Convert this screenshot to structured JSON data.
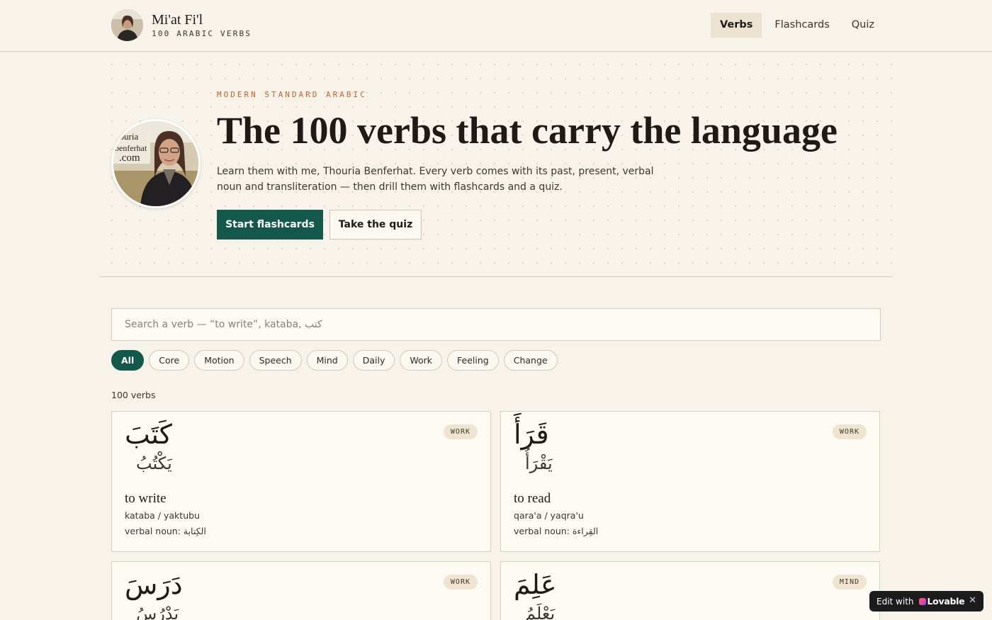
{
  "header": {
    "title": "Mi'at Fi'l",
    "subtitle": "100 ARABIC VERBS",
    "nav": [
      {
        "label": "Verbs",
        "active": true
      },
      {
        "label": "Flashcards",
        "active": false
      },
      {
        "label": "Quiz",
        "active": false
      }
    ]
  },
  "hero": {
    "eyebrow": "MODERN STANDARD ARABIC",
    "title": "The 100 verbs that carry the language",
    "description": "Learn them with me, Thouria Benferhat. Every verb comes with its past, present, verbal noun and transliteration — then drill them with flashcards and a quiz.",
    "primary_button": "Start flashcards",
    "secondary_button": "Take the quiz"
  },
  "search": {
    "placeholder": "Search a verb — “to write”, kataba, كتب",
    "value": ""
  },
  "filters": [
    "All",
    "Core",
    "Motion",
    "Speech",
    "Mind",
    "Daily",
    "Work",
    "Feeling",
    "Change"
  ],
  "active_filter": "All",
  "count_label": "100 verbs",
  "cards": [
    {
      "past": "كَتَبَ",
      "present": "يَكْتُبُ",
      "tag": "WORK",
      "meaning": "to write",
      "translit": "kataba / yaktubu",
      "vnoun": "verbal noun: الكِتابة"
    },
    {
      "past": "قَرَأَ",
      "present": "يَقْرَأُ",
      "tag": "WORK",
      "meaning": "to read",
      "translit": "qara'a / yaqra'u",
      "vnoun": "verbal noun: القِراءة"
    },
    {
      "past": "دَرَسَ",
      "present": "يَدْرُسُ",
      "tag": "WORK"
    },
    {
      "past": "عَلِمَ",
      "present": "يَعْلَمُ",
      "tag": "MIND"
    }
  ],
  "badge": {
    "prefix": "Edit with",
    "brand": "Lovable",
    "close": "✕"
  },
  "colors": {
    "background": "#f8f3ea",
    "accent": "#13584a",
    "eyebrow": "#c0652b"
  }
}
